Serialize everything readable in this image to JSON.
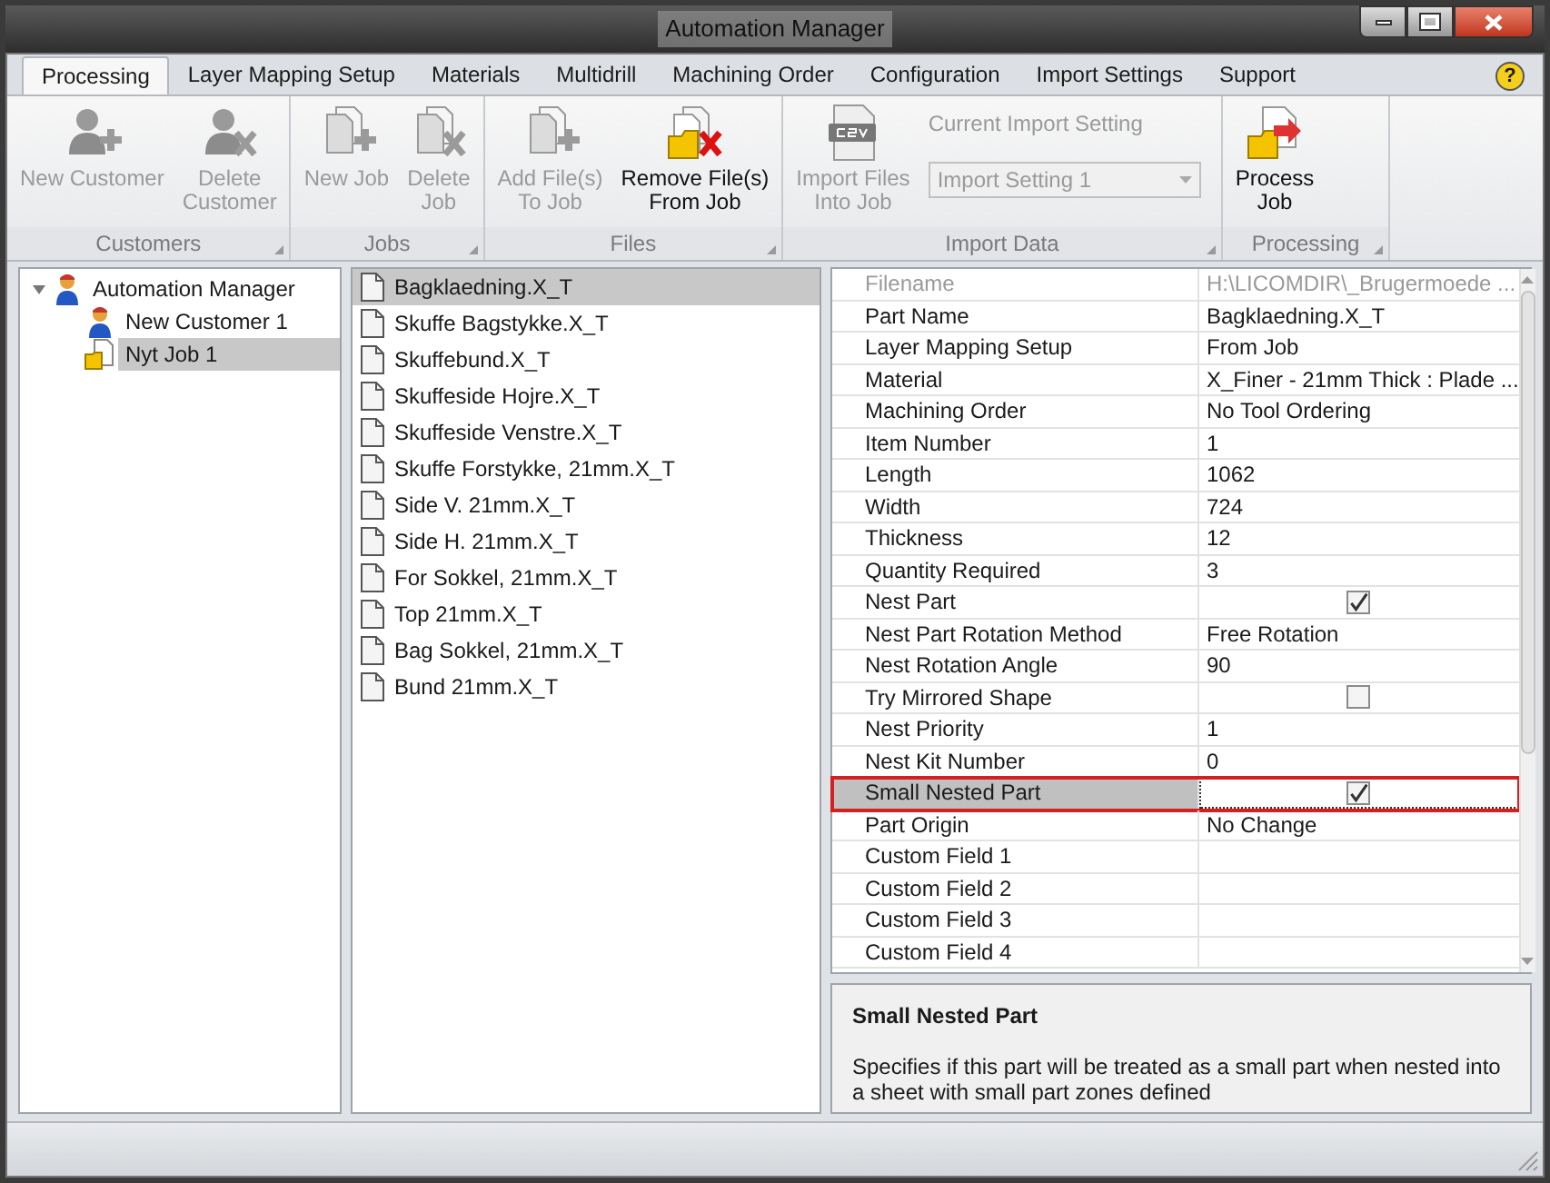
{
  "window": {
    "title": "Automation Manager"
  },
  "tabs": [
    {
      "label": "Processing",
      "selected": true
    },
    {
      "label": "Layer Mapping Setup",
      "selected": false
    },
    {
      "label": "Materials",
      "selected": false
    },
    {
      "label": "Multidrill",
      "selected": false
    },
    {
      "label": "Machining Order",
      "selected": false
    },
    {
      "label": "Configuration",
      "selected": false
    },
    {
      "label": "Import Settings",
      "selected": false
    },
    {
      "label": "Support",
      "selected": false
    }
  ],
  "help": {
    "label": "?"
  },
  "ribbon": {
    "groups": [
      {
        "title": "Customers",
        "buttons": [
          {
            "kind": "customer-add",
            "label": "New Customer",
            "disabled": true
          },
          {
            "kind": "customer-delete",
            "label": "Delete\nCustomer",
            "disabled": true
          }
        ]
      },
      {
        "title": "Jobs",
        "buttons": [
          {
            "kind": "job-add",
            "label": "New Job",
            "disabled": true
          },
          {
            "kind": "job-delete",
            "label": "Delete\nJob",
            "disabled": true
          }
        ]
      },
      {
        "title": "Files",
        "buttons": [
          {
            "kind": "file-add",
            "label": "Add File(s)\nTo Job",
            "disabled": true
          },
          {
            "kind": "file-remove",
            "label": "Remove File(s)\nFrom Job",
            "disabled": false
          }
        ]
      },
      {
        "title": "Import Data",
        "buttons": [
          {
            "kind": "csv",
            "label": "Import Files\nInto Job",
            "disabled": true
          }
        ],
        "setting": {
          "label": "Current Import Setting",
          "value": "Import Setting 1",
          "disabled": true
        }
      },
      {
        "title": "Processing",
        "buttons": [
          {
            "kind": "process",
            "label": "Process\nJob",
            "disabled": false
          }
        ]
      }
    ]
  },
  "tree": [
    {
      "kind": "manager",
      "label": "Automation Manager",
      "selected": false,
      "expanded": true,
      "children": [
        {
          "kind": "customer",
          "label": "New Customer 1",
          "selected": false
        },
        {
          "kind": "job",
          "label": "Nyt Job 1",
          "selected": true
        }
      ]
    }
  ],
  "files": [
    {
      "label": "Bagklaedning.X_T",
      "selected": true
    },
    {
      "label": "Skuffe Bagstykke.X_T",
      "selected": false
    },
    {
      "label": "Skuffebund.X_T",
      "selected": false
    },
    {
      "label": "Skuffeside Hojre.X_T",
      "selected": false
    },
    {
      "label": "Skuffeside Venstre.X_T",
      "selected": false
    },
    {
      "label": "Skuffe Forstykke, 21mm.X_T",
      "selected": false
    },
    {
      "label": "Side V. 21mm.X_T",
      "selected": false
    },
    {
      "label": "Side H. 21mm.X_T",
      "selected": false
    },
    {
      "label": "For Sokkel, 21mm.X_T",
      "selected": false
    },
    {
      "label": "Top 21mm.X_T",
      "selected": false
    },
    {
      "label": "Bag Sokkel, 21mm.X_T",
      "selected": false
    },
    {
      "label": "Bund 21mm.X_T",
      "selected": false
    }
  ],
  "properties": [
    {
      "kind": "text",
      "name": "Filename",
      "value": "H:\\LICOMDIR\\_Brugermoede ...",
      "disabled": true,
      "selected": false
    },
    {
      "kind": "text",
      "name": "Part Name",
      "value": "Bagklaedning.X_T",
      "disabled": false,
      "selected": false
    },
    {
      "kind": "text",
      "name": "Layer Mapping Setup",
      "value": "From Job",
      "disabled": false,
      "selected": false
    },
    {
      "kind": "text",
      "name": "Material",
      "value": "X_Finer - 21mm Thick : Plade ...",
      "disabled": false,
      "selected": false
    },
    {
      "kind": "text",
      "name": "Machining Order",
      "value": "No Tool Ordering",
      "disabled": false,
      "selected": false
    },
    {
      "kind": "text",
      "name": "Item Number",
      "value": "1",
      "disabled": false,
      "selected": false
    },
    {
      "kind": "text",
      "name": "Length",
      "value": "1062",
      "disabled": false,
      "selected": false
    },
    {
      "kind": "text",
      "name": "Width",
      "value": "724",
      "disabled": false,
      "selected": false
    },
    {
      "kind": "text",
      "name": "Thickness",
      "value": "12",
      "disabled": false,
      "selected": false
    },
    {
      "kind": "text",
      "name": "Quantity Required",
      "value": "3",
      "disabled": false,
      "selected": false
    },
    {
      "kind": "checkbox",
      "name": "Nest Part",
      "checked": true,
      "disabled": false,
      "selected": false
    },
    {
      "kind": "text",
      "name": "Nest Part Rotation Method",
      "value": "Free Rotation",
      "disabled": false,
      "selected": false
    },
    {
      "kind": "text",
      "name": "Nest Rotation Angle",
      "value": "90",
      "disabled": false,
      "selected": false
    },
    {
      "kind": "checkbox",
      "name": "Try Mirrored Shape",
      "checked": false,
      "disabled": false,
      "selected": false
    },
    {
      "kind": "text",
      "name": "Nest Priority",
      "value": "1",
      "disabled": false,
      "selected": false
    },
    {
      "kind": "text",
      "name": "Nest Kit Number",
      "value": "0",
      "disabled": false,
      "selected": false
    },
    {
      "kind": "checkbox",
      "name": "Small Nested Part",
      "checked": true,
      "disabled": false,
      "selected": true
    },
    {
      "kind": "text",
      "name": "Part Origin",
      "value": "No Change",
      "disabled": false,
      "selected": false
    },
    {
      "kind": "text",
      "name": "Custom Field 1",
      "disabled": false,
      "selected": false
    },
    {
      "kind": "text",
      "name": "Custom Field 2",
      "disabled": false,
      "selected": false
    },
    {
      "kind": "text",
      "name": "Custom Field 3",
      "disabled": false,
      "selected": false
    },
    {
      "kind": "text",
      "name": "Custom Field 4",
      "disabled": false,
      "selected": false
    }
  ],
  "description": {
    "title": "Small Nested Part",
    "text": "Specifies if this part will be treated as a small part when nested into a sheet with small part zones defined"
  }
}
